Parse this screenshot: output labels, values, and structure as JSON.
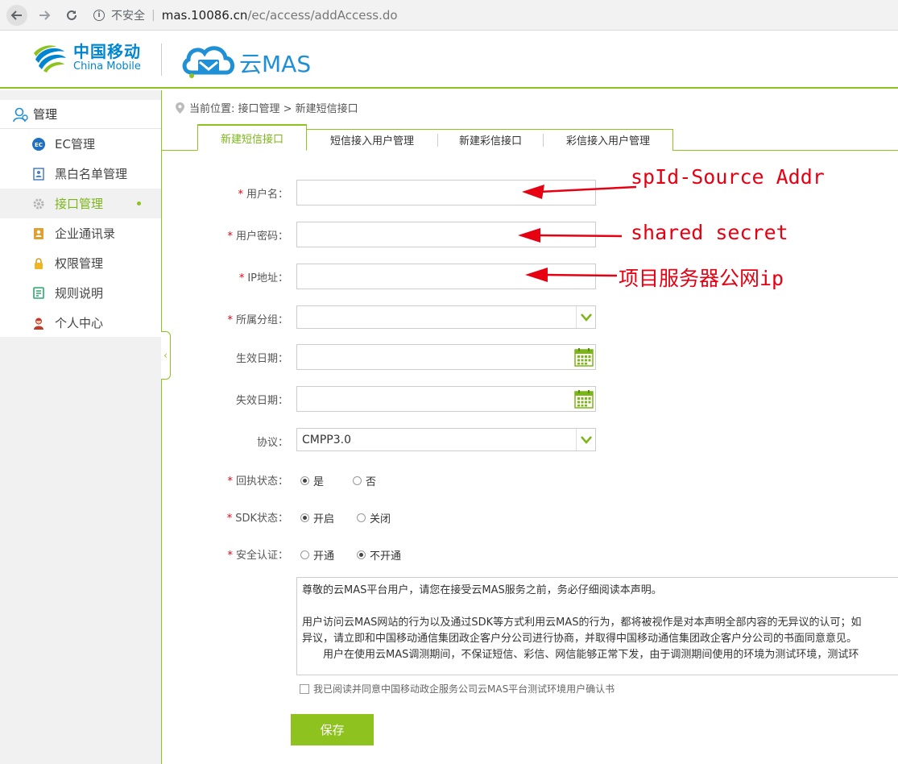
{
  "browser": {
    "security_label": "不安全",
    "url_host": "mas.10086.cn",
    "url_path": "/ec/access/addAccess.do"
  },
  "header": {
    "brand_cn": "中国移动",
    "brand_en": "China Mobile",
    "product_name": "云MAS",
    "accent_color": "#8dc21f",
    "brand_color": "#0085d0"
  },
  "sidebar": {
    "title": "管理",
    "items": [
      {
        "label": "EC管理",
        "icon": "ec-icon"
      },
      {
        "label": "黑白名单管理",
        "icon": "list-icon"
      },
      {
        "label": "接口管理",
        "icon": "gear-icon",
        "active": true
      },
      {
        "label": "企业通讯录",
        "icon": "contacts-icon"
      },
      {
        "label": "权限管理",
        "icon": "lock-icon"
      },
      {
        "label": "规则说明",
        "icon": "rules-icon"
      },
      {
        "label": "个人中心",
        "icon": "user-icon"
      }
    ]
  },
  "breadcrumb": {
    "text": "当前位置: 接口管理 > 新建短信接口"
  },
  "tabs": [
    {
      "label": "新建短信接口",
      "active": true
    },
    {
      "label": "短信接入用户管理"
    },
    {
      "label": "新建彩信接口"
    },
    {
      "label": "彩信接入用户管理"
    }
  ],
  "form": {
    "username_label": "用户名：",
    "username_value": "",
    "password_label": "用户密码：",
    "password_value": "",
    "ip_label": "IP地址：",
    "ip_value": "",
    "group_label": "所属分组：",
    "group_value": "",
    "start_date_label": "生效日期：",
    "start_date_value": "",
    "end_date_label": "失效日期：",
    "end_date_value": "",
    "protocol_label": "协议：",
    "protocol_value": "CMPP3.0",
    "receipt_label": "回执状态：",
    "receipt_options": [
      "是",
      "否"
    ],
    "receipt_selected": "是",
    "sdk_label": "SDK状态：",
    "sdk_options": [
      "开启",
      "关闭"
    ],
    "sdk_selected": "开启",
    "auth_label": "安全认证：",
    "auth_options": [
      "开通",
      "不开通"
    ],
    "auth_selected": "不开通",
    "required_mark": "*"
  },
  "agreement": {
    "p1": "尊敬的云MAS平台用户，请您在接受云MAS服务之前，务必仔细阅读本声明。",
    "p2a": "用户访问云MAS网站的行为以及通过SDK等方式利用云MAS的行为，都将被视作是对本声明全部内容的无异议的认可；如",
    "p2b": "异议，请立即和中国移动通信集团政企客户分公司进行协商，并取得中国移动通信集团政企客户分公司的书面同意意见。",
    "p3": "用户在使用云MAS调测期间，不保证短信、彩信、网信能够正常下发，由于调测期间使用的环境为测试环境，测试环",
    "checkbox_label": "我已阅读并同意中国移动政企服务公司云MAS平台测试环境用户确认书"
  },
  "save_label": "保存",
  "annotations": {
    "username_note": "spId-Source Addr",
    "password_note": "shared secret",
    "ip_note": "项目服务器公网ip",
    "color": "#e60012"
  }
}
